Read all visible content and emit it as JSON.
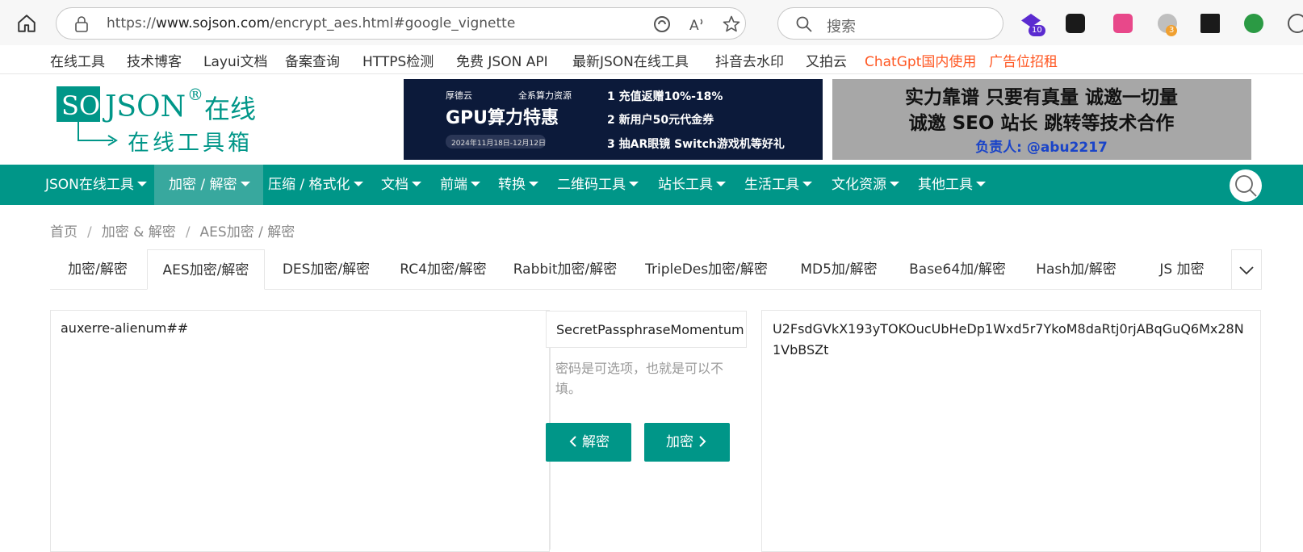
{
  "browser": {
    "url_prefix": "https://",
    "url_domain": "www.sojson.com",
    "url_path": "/encrypt_aes.html#google_vignette",
    "search_placeholder": "搜索",
    "extensions": [
      {
        "name": "graduation-cap-extension",
        "badge": "10"
      },
      {
        "name": "game-extension",
        "badge": ""
      },
      {
        "name": "translate-extension",
        "badge": ""
      },
      {
        "name": "circle-extension",
        "badge": "3"
      },
      {
        "name": "box-extension",
        "badge": ""
      },
      {
        "name": "globe-extension",
        "badge": ""
      }
    ]
  },
  "toplinks": [
    "在线工具",
    "技术博客",
    "Layui文档",
    "备案查询",
    "HTTPS检测",
    "免费 JSON API",
    "最新JSON在线工具",
    "抖音去水印",
    "又拍云",
    "ChatGpt国内使用",
    "广告位招租"
  ],
  "logo": {
    "so": "SO",
    "json": "JSON",
    "reg": "®",
    "zaixian": "在线",
    "subtitle": "在线工具箱"
  },
  "banner1": {
    "brand": "厚德云",
    "tag": "全系算力资源",
    "headline": "GPU算力特惠",
    "date": "2024年11月18日-12月12日",
    "points": [
      "1 充值返赠10%-18%",
      "2 新用户50元代金券",
      "3 抽AR眼镜 Switch游戏机等好礼"
    ]
  },
  "banner2": {
    "line1": "实力靠谱  只要有真量  诚邀一切量",
    "line2": "诚邀  SEO  站长  跳转等技术合作",
    "line3": "负责人: @abu2217"
  },
  "nav": [
    "JSON在线工具",
    "加密 / 解密",
    "压缩 / 格式化",
    "文档",
    "前端",
    "转换",
    "二维码工具",
    "站长工具",
    "生活工具",
    "文化资源",
    "其他工具"
  ],
  "breadcrumb": [
    "首页",
    "加密 & 解密",
    "AES加密 / 解密"
  ],
  "tabs": [
    "加密/解密",
    "AES加密/解密",
    "DES加密/解密",
    "RC4加密/解密",
    "Rabbit加密/解密",
    "TripleDes加密/解密",
    "MD5加/解密",
    "Base64加/解密",
    "Hash加/解密",
    "JS 加密"
  ],
  "input_text": "auxerre-alienum##",
  "password_value": "SecretPassphraseMomentum",
  "password_hint": "密码是可选项，也就是可以不填。",
  "decrypt_label": "解密",
  "encrypt_label": "加密",
  "output_text": "U2FsdGVkX193yTOKOucUbHeDp1Wxd5r7YkoM8daRtj0rjABqGuQ6Mx28N1VbBSZt",
  "colors": {
    "primary": "#009688",
    "nav_active": "#38a89e",
    "link_red": "#ff5722"
  }
}
